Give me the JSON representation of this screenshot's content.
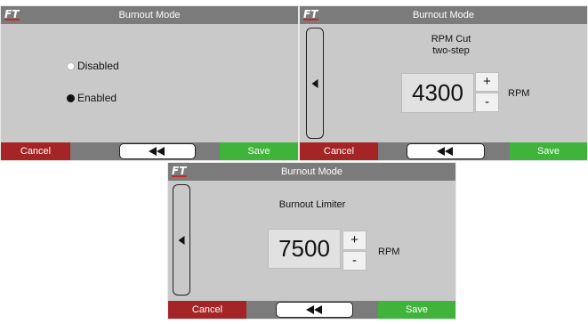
{
  "colors": {
    "titlebar": "#7b7b7b",
    "panel_bg": "#c9c9c9",
    "cancel": "#a52426",
    "save": "#3fb33a"
  },
  "panels": [
    {
      "title": "Burnout Mode",
      "options": [
        {
          "label": "Disabled",
          "selected": false
        },
        {
          "label": "Enabled",
          "selected": true
        }
      ],
      "footer": {
        "cancel": "Cancel",
        "save": "Save",
        "back_icon": "double-left-arrow-icon"
      }
    },
    {
      "title": "Burnout Mode",
      "heading_line1": "RPM  Cut",
      "heading_line2": "two-step",
      "value": "4300",
      "plus": "+",
      "minus": "-",
      "unit": "RPM",
      "footer": {
        "cancel": "Cancel",
        "save": "Save",
        "back_icon": "double-left-arrow-icon"
      }
    },
    {
      "title": "Burnout Mode",
      "heading_line1": "Burnout Limiter",
      "value": "7500",
      "plus": "+",
      "minus": "-",
      "unit": "RPM",
      "footer": {
        "cancel": "Cancel",
        "save": "Save",
        "back_icon": "double-left-arrow-icon"
      }
    }
  ]
}
